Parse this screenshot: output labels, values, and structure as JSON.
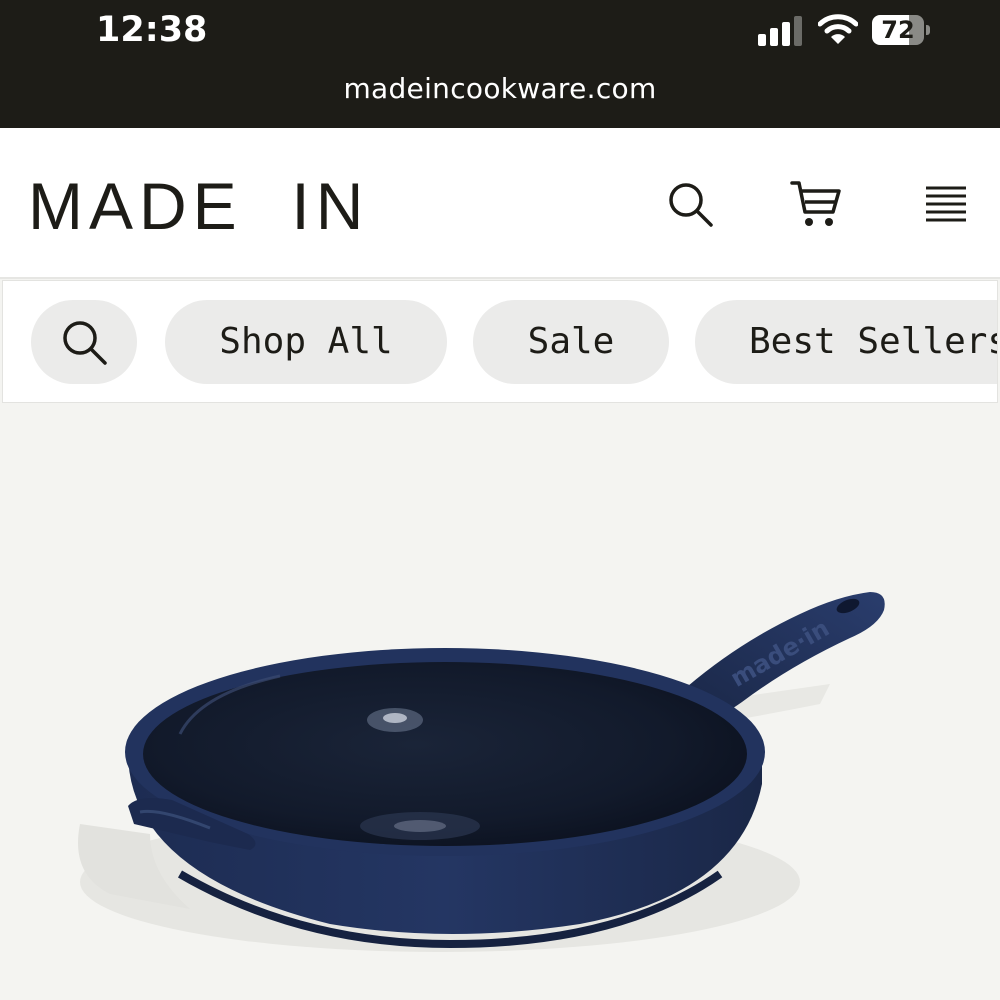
{
  "status_bar": {
    "time": "12:38",
    "battery_percent": "72",
    "battery_level": 0.72,
    "signal_bars": 3,
    "url": "madeincookware.com"
  },
  "header": {
    "logo": "MADE  IN",
    "icons": [
      "search-icon",
      "cart-icon",
      "menu-icon"
    ]
  },
  "nav": {
    "chips": [
      {
        "label": "Shop All"
      },
      {
        "label": "Sale"
      },
      {
        "label": "Best Sellers"
      }
    ]
  },
  "hero": {
    "product_image": "navy cast iron skillet",
    "handle_engraving": "made·in"
  },
  "colors": {
    "top_bar": "#1d1c17",
    "header_bg": "#ffffff",
    "chip_bg": "#ebebea",
    "hero_bg": "#f4f4f1",
    "skillet_navy": "#1b2a4e"
  }
}
